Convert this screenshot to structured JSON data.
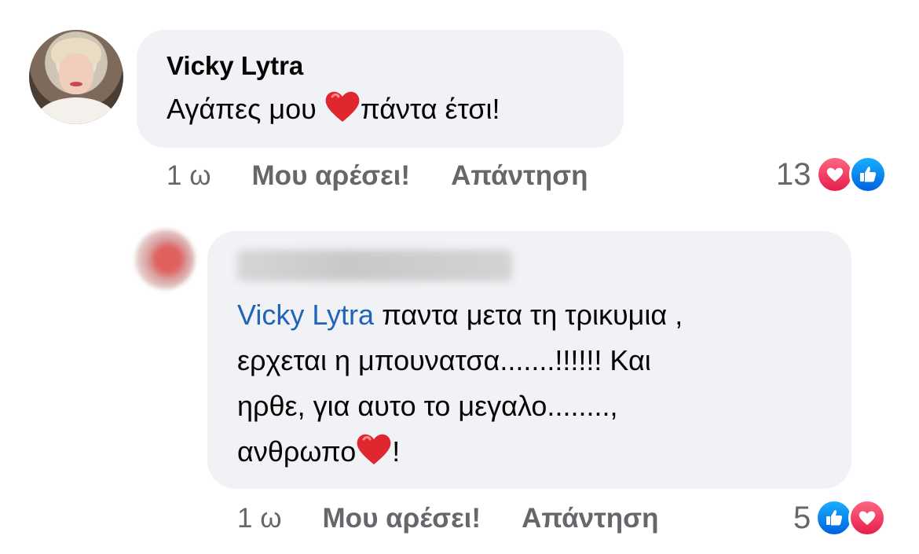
{
  "comment": {
    "author": "Vicky Lytra",
    "text_before": "Αγάπες μου ",
    "text_after": "πάντα έτσι!",
    "emoji": "red-heart",
    "time": "1 ω",
    "like_label": "Μου αρέσει!",
    "reply_label": "Απάντηση",
    "reaction_count": "13",
    "reactions": [
      "love",
      "like"
    ]
  },
  "reply": {
    "mention": "Vicky Lytra",
    "line1_rest": " παντα μετα τη τρικυμια ,",
    "line2": "ερχεται η μπουνατσα.......!!!!!! Και",
    "line3": "ηρθε, για αυτο το μεγαλο........,",
    "line4_before": "ανθρωπο",
    "line4_after": "!",
    "emoji": "red-heart",
    "time": "1 ω",
    "like_label": "Μου αρέσει!",
    "reply_label": "Απάντηση",
    "reaction_count": "5",
    "reactions": [
      "like",
      "love"
    ]
  },
  "colors": {
    "bubble": "#f0f2f5",
    "meta_text": "#65676b",
    "mention": "#1f64b8",
    "love": "#f33e58",
    "like": "#1877f2"
  }
}
